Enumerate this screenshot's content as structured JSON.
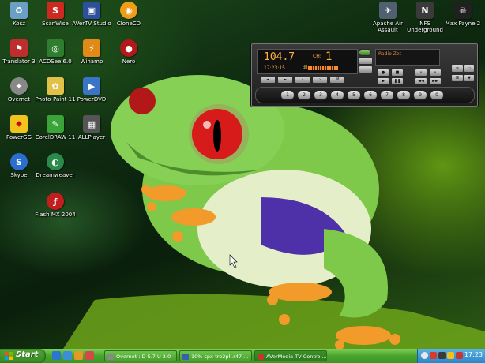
{
  "desktop_icons_left": [
    {
      "id": "kosz",
      "label": "Kosz",
      "icon": "recycle-bin-icon",
      "color": "#6c9fc6"
    },
    {
      "id": "scanwise",
      "label": "ScanWise",
      "icon": "scanwise-icon",
      "color": "#cc2a20"
    },
    {
      "id": "avertv",
      "label": "AVerTV Studio",
      "icon": "avertv-icon",
      "color": "#2d4f9c"
    },
    {
      "id": "clonecd",
      "label": "CloneCD",
      "icon": "clonecd-icon",
      "color": "#ef9d17"
    },
    {
      "id": "translator",
      "label": "Translator 3",
      "icon": "translator-icon",
      "color": "#c02d2d"
    },
    {
      "id": "acdsee",
      "label": "ACDSee 6.0",
      "icon": "acdsee-icon",
      "color": "#2f7d2f"
    },
    {
      "id": "winamp",
      "label": "Winamp",
      "icon": "winamp-icon",
      "color": "#e18a17"
    },
    {
      "id": "nero",
      "label": "Nero",
      "icon": "nero-icon",
      "color": "#b6171a"
    },
    {
      "id": "overnet",
      "label": "Overnet",
      "icon": "overnet-icon",
      "color": "#888"
    },
    {
      "id": "photopaint",
      "label": "Photo-Paint 11",
      "icon": "photo-paint-icon",
      "color": "#e1c14a"
    },
    {
      "id": "powerdvd",
      "label": "PowerDVD",
      "icon": "powerdvd-icon",
      "color": "#3a74c6"
    },
    {
      "id": "powergg",
      "label": "PowerGG",
      "icon": "powergg-icon",
      "color": "#f0c41a"
    },
    {
      "id": "coreldraw",
      "label": "CorelDRAW 11",
      "icon": "coreldraw-icon",
      "color": "#3aa33a"
    },
    {
      "id": "allplayer",
      "label": "ALLPlayer",
      "icon": "allplayer-icon",
      "color": "#555"
    },
    {
      "id": "skype",
      "label": "Skype",
      "icon": "skype-icon",
      "color": "#2a6fd0"
    },
    {
      "id": "dreamweaver",
      "label": "Dreamweaver",
      "icon": "dreamweaver-icon",
      "color": "#2a8a4a"
    },
    {
      "id": "flashmx",
      "label": "Flash MX 2004",
      "icon": "flash-icon",
      "color": "#c21e1e"
    }
  ],
  "desktop_icons_right": [
    {
      "id": "apache",
      "label": "Apache Air Assault",
      "icon": "apache-air-assault-icon",
      "color": "#506070"
    },
    {
      "id": "nfs",
      "label": "NFS Underground",
      "icon": "nfs-underground-icon",
      "color": "#3a3a3a"
    },
    {
      "id": "maxpayne",
      "label": "Max Payne 2",
      "icon": "max-payne-icon",
      "color": "#202020"
    }
  ],
  "radio": {
    "frequency": "104.7",
    "channel_label": "CH:",
    "channel": "1",
    "time": "17:23:15",
    "db_label": "dB",
    "station": "Radio Zet",
    "volume_level_pct": 68,
    "presets": [
      "1",
      "2",
      "3",
      "4",
      "5",
      "6",
      "7",
      "8",
      "9",
      "0"
    ]
  },
  "taskbar": {
    "start_label": "Start",
    "tasks": [
      {
        "label": "Overnet : D 5.7 U 2.0",
        "active": false
      },
      {
        "label": "10% spx-tro2pll.r47 ...",
        "active": false
      },
      {
        "label": "AVerMedia TV Control...",
        "active": true
      }
    ],
    "clock": "17:23"
  }
}
